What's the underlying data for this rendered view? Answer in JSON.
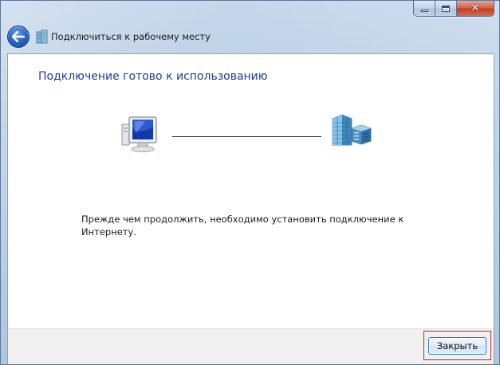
{
  "window": {
    "title": "Подключиться к рабочему месту",
    "caption_buttons": {
      "minimize_icon": "minimize-icon",
      "maximize_icon": "maximize-icon",
      "close_glyph": "✕"
    }
  },
  "content": {
    "heading": "Подключение готово к использованию",
    "message": "Прежде чем продолжить, необходимо установить подключение к Интернету.",
    "icons": {
      "left": "computer-icon",
      "right": "office-building-icon",
      "title": "workplace-icon",
      "back": "back-arrow-icon"
    }
  },
  "footer": {
    "close_label": "Закрыть"
  },
  "colors": {
    "heading": "#1e3f90",
    "highlight": "#c0292c",
    "button_border": "#2a7ac0"
  }
}
